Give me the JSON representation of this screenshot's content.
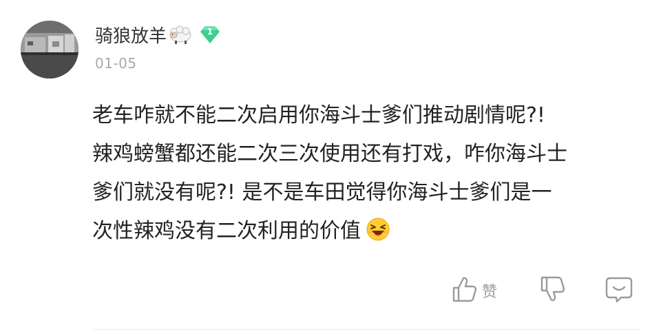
{
  "comment": {
    "username": "骑狼放羊",
    "level": "1",
    "date": "01-05",
    "lines": [
      "老车咋就不能二次启用你海斗士爹们推动剧情呢?!",
      "辣鸡螃蟹都还能二次三次使用还有打戏，咋你海斗士",
      "爹们就没有呢?! 是不是车田觉得你海斗士爹们是一",
      "次性辣鸡没有二次利用的价值"
    ],
    "like_label": "赞"
  },
  "icons": {
    "sheep": "sheep-emoji-icon",
    "badge": "level-diamond-icon",
    "emoji": "squinting-laugh-emoji-icon",
    "like": "thumbs-up-icon",
    "dislike": "thumbs-down-icon",
    "comment": "comment-bubble-icon"
  },
  "colors": {
    "badge": "#3ecf8e",
    "text": "#222222",
    "meta": "#a8a8a8",
    "action": "#9a9a9a"
  }
}
